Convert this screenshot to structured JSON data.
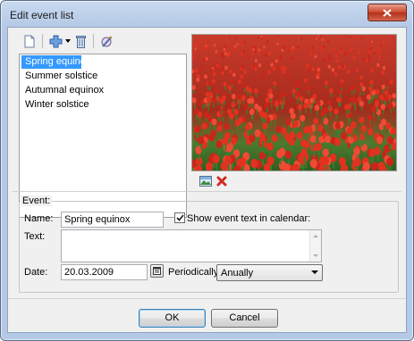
{
  "window": {
    "title": "Edit event list"
  },
  "toolbar": {
    "icons": [
      "new-document-icon",
      "add-icon",
      "dropdown-arrow-icon",
      "delete-icon",
      "edit-icon"
    ]
  },
  "events": [
    {
      "label": "Spring equinox",
      "selected": true
    },
    {
      "label": "Summer solstice",
      "selected": false
    },
    {
      "label": "Autumnal equinox",
      "selected": false
    },
    {
      "label": "Winter solstice",
      "selected": false
    }
  ],
  "image_tools": [
    "picture-icon",
    "remove-icon"
  ],
  "group": {
    "legend": "Event:"
  },
  "form": {
    "name_label": "Name:",
    "name_value": "Spring equinox",
    "show_in_calendar_label": "Show event text in calendar:",
    "show_in_calendar_checked": true,
    "text_label": "Text:",
    "text_value": "",
    "date_label": "Date:",
    "date_value": "20.03.2009",
    "periodically_label": "Periodically:",
    "periodically_value": "Anually"
  },
  "buttons": {
    "ok": "OK",
    "cancel": "Cancel"
  },
  "colors": {
    "selection": "#3399ff",
    "tulip_red": "#d8261c",
    "leaf_green": "#3f7a2c"
  }
}
